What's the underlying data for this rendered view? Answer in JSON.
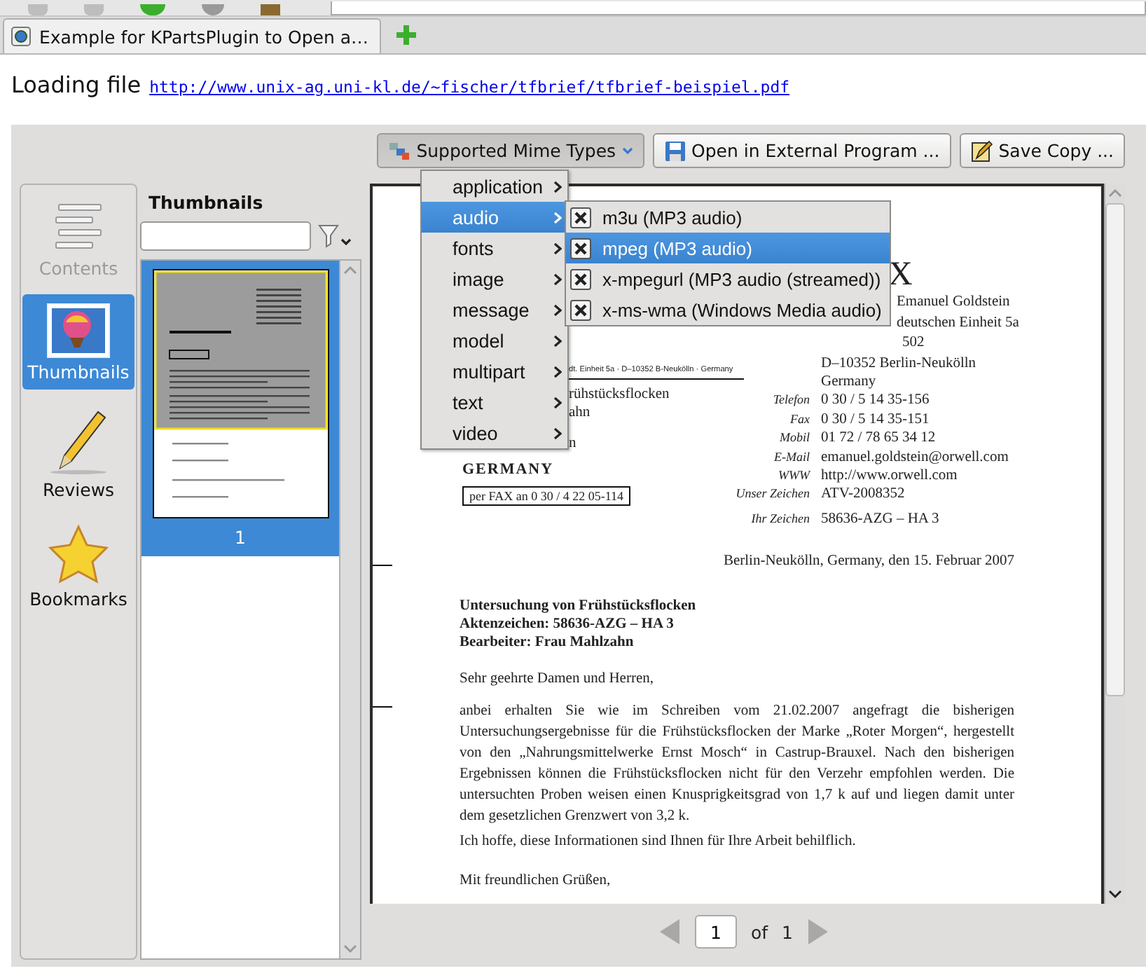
{
  "browser_tab": {
    "title": "Example for KPartsPlugin to Open a…"
  },
  "loading": {
    "label": "Loading file",
    "url": "http://www.unix-ag.uni-kl.de/~fischer/tfbrief/tfbrief-beispiel.pdf"
  },
  "toolbar": [
    {
      "label": "Supported Mime Types",
      "kind": "menu",
      "expanded": true
    },
    {
      "label": "Open in External Program ...",
      "kind": "button",
      "expanded": false
    },
    {
      "label": "Save Copy ...",
      "kind": "button",
      "expanded": false
    }
  ],
  "mime_menu": {
    "items": [
      {
        "label": "application",
        "selected": false
      },
      {
        "label": "audio",
        "selected": true
      },
      {
        "label": "fonts",
        "selected": false
      },
      {
        "label": "image",
        "selected": false
      },
      {
        "label": "message",
        "selected": false
      },
      {
        "label": "model",
        "selected": false
      },
      {
        "label": "multipart",
        "selected": false
      },
      {
        "label": "text",
        "selected": false
      },
      {
        "label": "video",
        "selected": false
      }
    ],
    "submenu": [
      {
        "label": "m3u (MP3 audio)",
        "checked": true,
        "selected": false
      },
      {
        "label": "mpeg (MP3 audio)",
        "checked": true,
        "selected": true
      },
      {
        "label": "x-mpegurl (MP3 audio (streamed))",
        "checked": true,
        "selected": false
      },
      {
        "label": "x-ms-wma (Windows Media audio)",
        "checked": true,
        "selected": false
      }
    ]
  },
  "sidebar": {
    "items": [
      {
        "label": "Contents",
        "selected": false,
        "disabled": true
      },
      {
        "label": "Thumbnails",
        "selected": true,
        "disabled": false
      },
      {
        "label": "Reviews",
        "selected": false,
        "disabled": false
      },
      {
        "label": "Bookmarks",
        "selected": false,
        "disabled": false
      }
    ]
  },
  "thumbnails": {
    "title": "Thumbnails",
    "pages": [
      {
        "label": "1",
        "selected": true
      }
    ]
  },
  "document": {
    "letterhead_fragment": "X",
    "address_fragments": [
      "Emanuel Goldstein",
      "deutschen Einheit 5a",
      "502"
    ],
    "address": [
      "D–10352 Berlin-Neukölln",
      "Germany"
    ],
    "sender_line_fragment": "dt. Einheit 5a · D–10352 B-Neukölln · Germany",
    "recipient_fragments": [
      "rühstücksflocken",
      "ahn",
      "n"
    ],
    "recipient_country": "GERMANY",
    "fax_note": "per FAX an 0 30 / 4 22 05-114",
    "contacts": [
      {
        "label": "Telefon",
        "value": "0 30 / 5 14 35-156"
      },
      {
        "label": "Fax",
        "value": "0 30 / 5 14 35-151"
      },
      {
        "label": "Mobil",
        "value": "01 72 / 78 65 34 12"
      },
      {
        "label": "E-Mail",
        "value": "emanuel.goldstein@orwell.com"
      },
      {
        "label": "WWW",
        "value": "http://www.orwell.com"
      },
      {
        "label": "Unser Zeichen",
        "value": "ATV-2008352"
      }
    ],
    "reference": {
      "label": "Ihr Zeichen",
      "value": "58636-AZG – HA 3"
    },
    "date": "Berlin-Neukölln, Germany, den 15. Februar 2007",
    "subject_lines": [
      "Untersuchung von Frühstücksflocken",
      "Aktenzeichen: 58636-AZG – HA 3",
      "Bearbeiter: Frau Mahlzahn"
    ],
    "salutation": "Sehr geehrte Damen und Herren,",
    "paragraphs": [
      "anbei erhalten Sie wie im Schreiben vom 21.02.2007 angefragt die bisherigen Untersuchungsergebnisse für die Frühstücksflocken der Marke „Roter Morgen“, hergestellt von den „Nahrungsmittelwerke Ernst Mosch“ in Castrup-Brauxel. Nach den bisherigen Ergebnissen können die Frühstücksflocken nicht für den Verzehr empfohlen werden. Die untersuchten Proben weisen einen Knusprigkeitsgrad von 1,7 k auf und liegen damit unter dem gesetzlichen Grenzwert von 3,2 k.",
      "Ich hoffe, diese Informationen sind Ihnen für Ihre Arbeit behilflich."
    ],
    "closing": "Mit freundlichen Grüßen,"
  },
  "pager": {
    "page": "1",
    "of": "of",
    "total": "1"
  }
}
